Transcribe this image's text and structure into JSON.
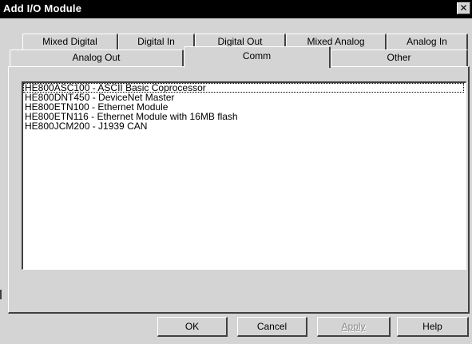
{
  "window": {
    "title": "Add I/O Module",
    "close_glyph": "✕"
  },
  "tabs_row1": [
    {
      "label": "Mixed Digital"
    },
    {
      "label": "Digital In"
    },
    {
      "label": "Digital Out"
    },
    {
      "label": "Mixed Analog"
    },
    {
      "label": "Analog In"
    }
  ],
  "tabs_row2": [
    {
      "label": "Analog Out"
    },
    {
      "label": "Comm",
      "active": true
    },
    {
      "label": "Other"
    }
  ],
  "modules": [
    {
      "label": "HE800ASC100  -  ASCII Basic Coprocessor",
      "selected": true
    },
    {
      "label": "HE800DNT450  -  DeviceNet Master"
    },
    {
      "label": "HE800ETN100  -  Ethernet Module"
    },
    {
      "label": "HE800ETN116  -  Ethernet Module with 16MB flash"
    },
    {
      "label": "HE800JCM200  -  J1939 CAN"
    }
  ],
  "buttons": {
    "ok": "OK",
    "cancel": "Cancel",
    "apply": "Apply",
    "help": "Help"
  }
}
